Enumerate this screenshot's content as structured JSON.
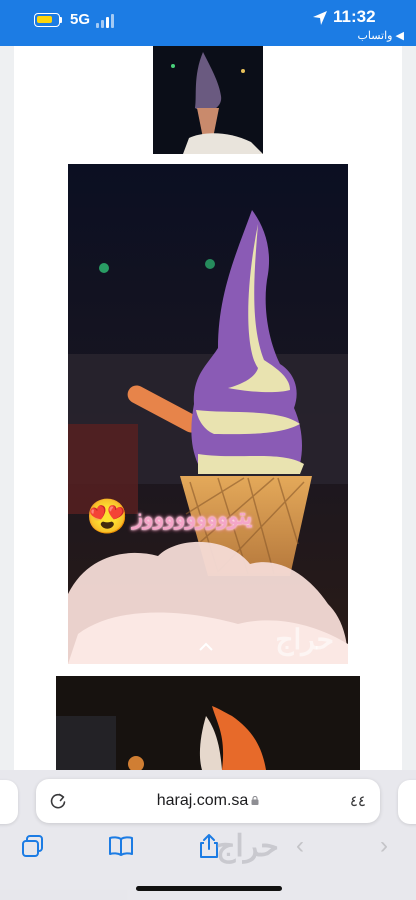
{
  "status_bar": {
    "network": "5G",
    "time": "11:32",
    "back_app": "◀ واتساب",
    "battery_color": "#ffd60a",
    "background": "#1c7ce4"
  },
  "post": {
    "caption_emoji": "😍",
    "caption": "يتوووووووووز",
    "watermark": "حراج"
  },
  "browser": {
    "url": "haraj.com.sa",
    "tab_count": "٤٤",
    "brand": "حراج",
    "toolbar_icons": [
      "tabs-icon",
      "bookmarks-icon",
      "share-icon"
    ]
  }
}
